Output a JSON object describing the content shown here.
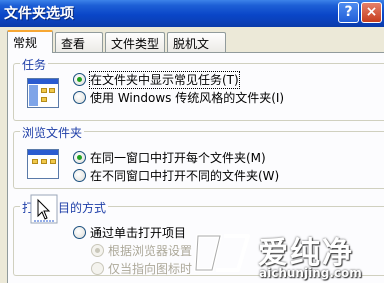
{
  "window": {
    "title": "文件夹选项",
    "help_label": "?",
    "close_label": "×"
  },
  "tabs": [
    {
      "label": "常规",
      "active": true
    },
    {
      "label": "查看",
      "active": false
    },
    {
      "label": "文件类型",
      "active": false
    },
    {
      "label": "脱机文件",
      "active": false
    }
  ],
  "groups": {
    "tasks": {
      "legend": "任务",
      "options": [
        {
          "label": "在文件夹中显示常见任务(T)",
          "checked": true
        },
        {
          "label": "使用 Windows 传统风格的文件夹(I)",
          "checked": false
        }
      ]
    },
    "browse": {
      "legend": "浏览文件夹",
      "options": [
        {
          "label": "在同一窗口中打开每个文件夹(M)",
          "checked": true
        },
        {
          "label": "在不同窗口中打开不同的文件夹(W)",
          "checked": false
        }
      ]
    },
    "open": {
      "legend": "打开项目的方式",
      "options": [
        {
          "label": "通过单击打开项目",
          "checked": false,
          "enabled": true
        },
        {
          "label": "根据浏览器设置",
          "checked": true,
          "enabled": false
        },
        {
          "label": "仅当指向图标时",
          "checked": false,
          "enabled": false
        }
      ]
    }
  },
  "watermark": {
    "name": "爱纯净",
    "url": "aichunjing.com"
  },
  "colors": {
    "titlebar": "#0a46c8",
    "legend_text": "#1f3fa8",
    "radio_dot": "#21a121",
    "tab_highlight": "#f7a733"
  }
}
